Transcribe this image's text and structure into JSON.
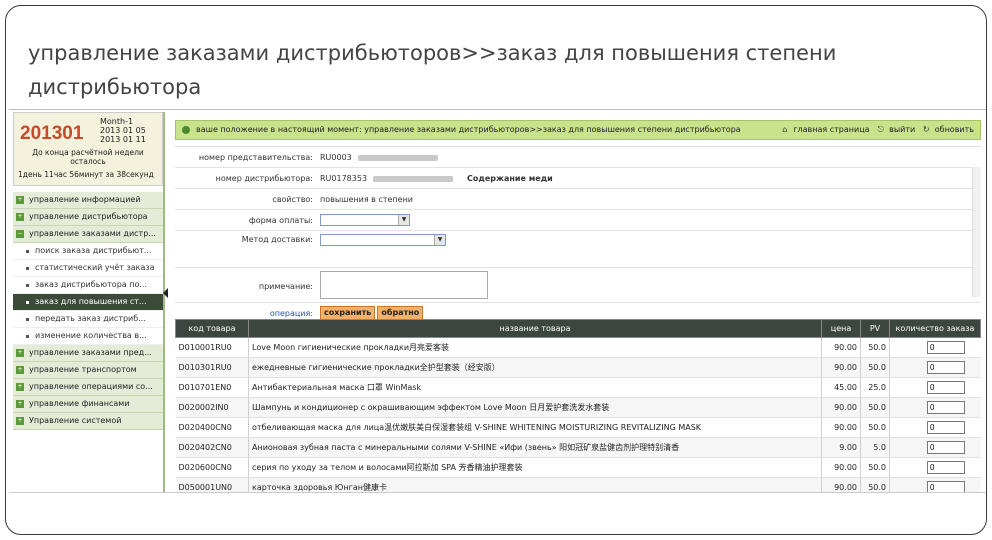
{
  "slide_title": "управление заказами дистрибьюторов>>заказ для повышения степени дистрибьютора",
  "info": {
    "week_number": "201301",
    "month_label": "Month-1",
    "date_start": "2013 01 05",
    "date_end": "2013 01 11",
    "deadline_line": "До конца расчётной недели осталось",
    "remaining_line": "1день 11час 56минут за 38секунд"
  },
  "menu": {
    "sections": [
      {
        "label": "управление информацией"
      },
      {
        "label": "управление дистрибьютора"
      },
      {
        "label": "управление заказами дистр..."
      }
    ],
    "sub_items": [
      {
        "label": "поиск заказа дистрибьют..."
      },
      {
        "label": "статистический учёт заказа"
      },
      {
        "label": "заказ дистрибьютора по..."
      },
      {
        "label": "заказ для повышения ст..."
      },
      {
        "label": "передать заказ дистриб..."
      },
      {
        "label": "изменение количества в..."
      }
    ],
    "sections_after": [
      {
        "label": "управление заказами пред..."
      },
      {
        "label": "управление транспортом"
      },
      {
        "label": "управление операциями со..."
      },
      {
        "label": "управление финансами"
      },
      {
        "label": "Управление системой"
      }
    ],
    "active_index": 3
  },
  "topbar": {
    "position_text": "ваше положение в настоящий момент: управление заказами дистрибьюторов>>заказ для повышения степени дистрибьютора",
    "home": "главная страница",
    "logout": "выйти",
    "refresh": "обновить"
  },
  "form": {
    "rep_label": "номер представительства:",
    "rep_value": "RU0003",
    "dist_label": "номер дистрибьютора:",
    "dist_value": "RU0178353",
    "dist_extra": "Содержание меди",
    "property_label": "свойство:",
    "property_value": "повышения в степени",
    "payment_label": "форма оплаты:",
    "delivery_label": "Метод доставки:",
    "note_label": "примечание:",
    "operation_label": "операция:",
    "save_button": "сохранить",
    "back_button": "обратно"
  },
  "table": {
    "headers": [
      "код товара",
      "название товара",
      "цена",
      "PV",
      "количество заказа"
    ],
    "rows": [
      {
        "code": "D010001RU0",
        "name": "Love Moon гигиенические прокладки月亮爱客装",
        "price": "90.00",
        "pv": "50.0",
        "qty": "0"
      },
      {
        "code": "D010301RU0",
        "name": "ежедневные гигиенические прокладки全护型套装（经安版）",
        "price": "90.00",
        "pv": "50.0",
        "qty": "0"
      },
      {
        "code": "D010701EN0",
        "name": "Антибактериальная маска 口罩 WinMask",
        "price": "45.00",
        "pv": "25.0",
        "qty": "0"
      },
      {
        "code": "D020002IN0",
        "name": "Шампунь и кондиционер с окрашивающим эффектом Love Moon 日月爱护套洗发水套装",
        "price": "90.00",
        "pv": "50.0",
        "qty": "0"
      },
      {
        "code": "D020400CN0",
        "name": "отбеливающая маска для лица温优嫩肤美白保湿套装组 V-SHINE WHITENING MOISTURIZING REVITALIZING MASK",
        "price": "90.00",
        "pv": "50.0",
        "qty": "0"
      },
      {
        "code": "D020402CN0",
        "name": "Анионовая зубная паста с минеральными солями V-SHINE «Ифи (звень» 阳如冠矿泉盐健齿剂护理特别清香",
        "price": "9.00",
        "pv": "5.0",
        "qty": "0"
      },
      {
        "code": "D020600CN0",
        "name": "серия по уходу за телом и волосами阿拉斯加 SPA 芳香精油护理套装",
        "price": "90.00",
        "pv": "50.0",
        "qty": "0"
      },
      {
        "code": "D050001UN0",
        "name": "карточка здоровья Юнган健康卡",
        "price": "90.00",
        "pv": "50.0",
        "qty": "0"
      }
    ]
  },
  "colors": {
    "topbar_bg": "#c9e38d",
    "header_bg": "#3c4640",
    "button_bg": "#f5b16a",
    "week_color": "#c8482a"
  }
}
